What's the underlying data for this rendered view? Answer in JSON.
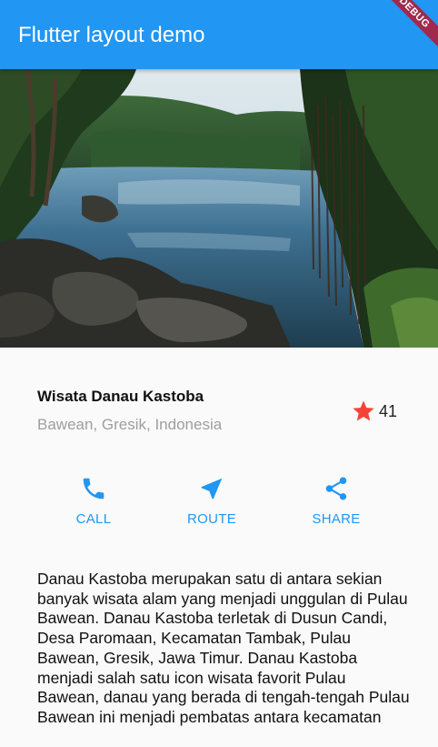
{
  "app_bar": {
    "title": "Flutter layout demo",
    "debug_banner": "DEBUG",
    "color": "#2196f3"
  },
  "hero_image": {
    "icon": "lake-photo",
    "description_visible": false
  },
  "place": {
    "name": "Wisata Danau Kastoba",
    "location": "Bawean, Gresik, Indonesia",
    "rating_icon": "star-icon",
    "rating_color": "#f44336",
    "rating_count": "41"
  },
  "actions": [
    {
      "label": "CALL",
      "icon": "phone-icon"
    },
    {
      "label": "ROUTE",
      "icon": "navigation-icon"
    },
    {
      "label": "SHARE",
      "icon": "share-icon"
    }
  ],
  "description": "Danau Kastoba merupakan satu di antara sekian banyak wisata alam yang menjadi unggulan di Pulau Bawean. Danau Kastoba terletak di Dusun Candi, Desa Paromaan, Kecamatan Tambak, Pulau Bawean, Gresik, Jawa Timur. Danau Kastoba menjadi salah satu icon wisata favorit Pulau Bawean, danau yang berada di tengah-tengah Pulau Bawean ini menjadi pembatas antara kecamatan"
}
